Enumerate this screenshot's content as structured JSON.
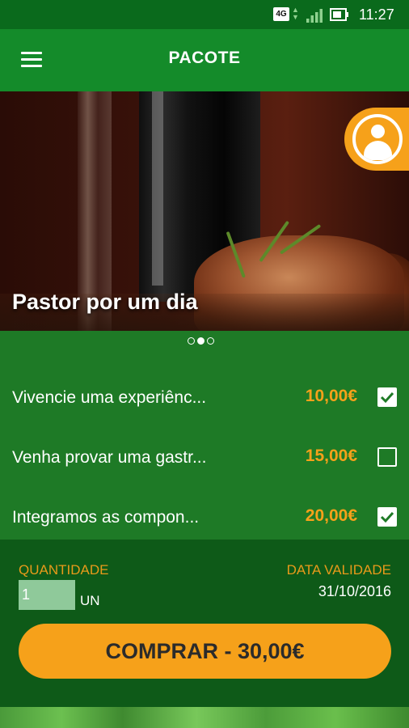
{
  "status_bar": {
    "network": "4G",
    "time": "11:27",
    "icons": [
      "signal-icon",
      "battery-icon"
    ]
  },
  "app_bar": {
    "title": "PACOTE",
    "menu_icon": "hamburger-menu-icon"
  },
  "hero": {
    "caption": "Pastor por um dia",
    "profile_icon": "user-profile-icon",
    "pager": {
      "count": 3,
      "active_index": 1
    }
  },
  "items": [
    {
      "name": "Vivencie uma experiênc...",
      "price": "10,00€",
      "checked": true
    },
    {
      "name": "Venha provar uma gastr...",
      "price": "15,00€",
      "checked": false
    },
    {
      "name": "Integramos as compon...",
      "price": "20,00€",
      "checked": true
    }
  ],
  "footer": {
    "quantity_label": "QUANTIDADE",
    "quantity_value": "1",
    "quantity_unit": "UN",
    "validity_label": "DATA VALIDADE",
    "validity_value": "31/10/2016",
    "buy_label": "COMPRAR - 30,00€"
  },
  "colors": {
    "primary_green": "#148b2a",
    "dark_green": "#0e5a18",
    "accent_orange": "#f6a11a"
  }
}
